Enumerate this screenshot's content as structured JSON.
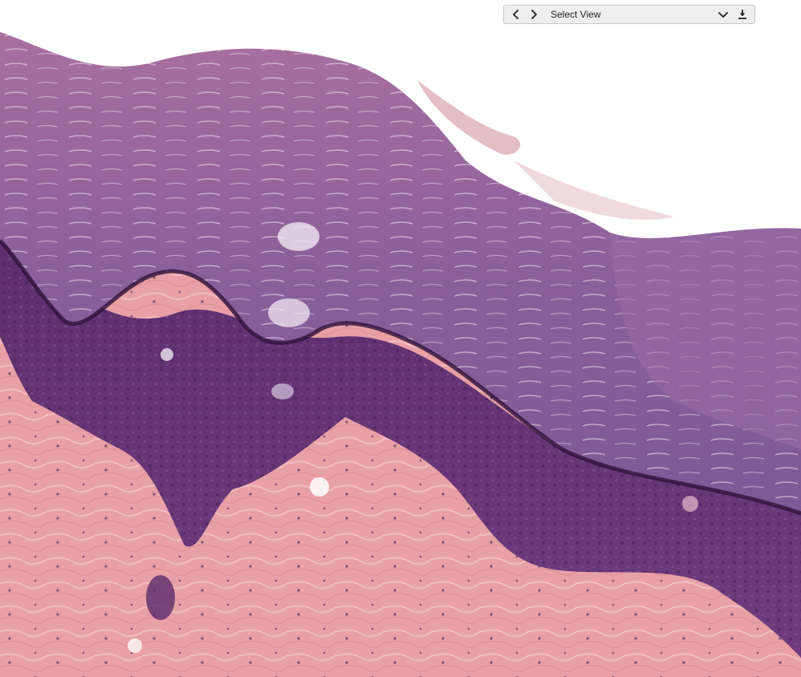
{
  "toolbar": {
    "view_select_label": "Select View",
    "icons": {
      "previous": "chevron-left-icon",
      "next": "chevron-right-icon",
      "dropdown": "chevron-down-icon",
      "download": "download-icon"
    }
  },
  "colors": {
    "toolbar_bg": "#eeeeee",
    "toolbar_border": "#c9c9c9",
    "background": "#ffffff",
    "stratum_corneum": "#8a5f9a",
    "epidermis": "#6a3a78",
    "dermis": "#e8a0a6"
  }
}
